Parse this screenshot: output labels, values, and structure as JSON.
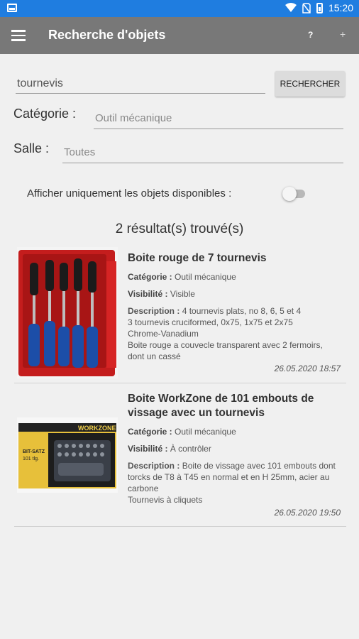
{
  "status_bar": {
    "time": "15:20"
  },
  "toolbar": {
    "title": "Recherche d'objets",
    "help_label": "?",
    "add_label": "+"
  },
  "search": {
    "value": "tournevis",
    "button_label": "RECHERCHER"
  },
  "filters": {
    "category_label": "Catégorie :",
    "category_value": "Outil mécanique",
    "room_label": "Salle :",
    "room_value": "Toutes",
    "available_only_label": "Afficher uniquement les objets disponibles :",
    "available_only": false
  },
  "results": {
    "count_text": "2 résultat(s) trouvé(s)",
    "items": [
      {
        "name": "Boite rouge de 7 tournevis",
        "category_label": "Catégorie :",
        "category": "Outil mécanique",
        "visibility_label": "Visibilité :",
        "visibility": "Visible",
        "description_label": "Description :",
        "description": "4 tournevis plats, no 8, 6, 5 et 4\n3 tournevis cruciformed, 0x75, 1x75 et 2x75\nChrome-Vanadium\nBoite rouge a couvecle transparent avec 2 fermoirs, dont un cassé",
        "date": "26.05.2020 18:57"
      },
      {
        "name": "Boite WorkZone de 101 embouts de vissage avec un tournevis",
        "category_label": "Catégorie :",
        "category": "Outil mécanique",
        "visibility_label": "Visibilité :",
        "visibility": "À contrôler",
        "description_label": "Description :",
        "description": "Boite de vissage avec 101 embouts dont torcks de T8 à T45 en normal et en H 25mm, acier au carbone\nTournevis à cliquets",
        "date": "26.05.2020 19:50",
        "image_text": {
          "brand": "WORKZONE",
          "line1": "BIT-SATZ",
          "line2": "101 tlg."
        }
      }
    ]
  },
  "colors": {
    "status_bar": "#1f7de0",
    "toolbar": "#787878",
    "background": "#f0f0f0"
  }
}
